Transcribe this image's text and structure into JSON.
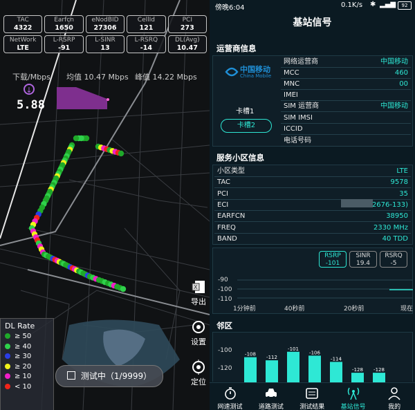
{
  "left": {
    "stats": [
      {
        "label": "TAC",
        "value": "4322"
      },
      {
        "label": "Earfcn",
        "value": "1650"
      },
      {
        "label": "eNodBID",
        "value": "27306"
      },
      {
        "label": "CellId",
        "value": "121"
      },
      {
        "label": "PCI",
        "value": "273"
      },
      {
        "label": "NetWork",
        "value": "LTE"
      },
      {
        "label": "L-RSRP",
        "value": "-91"
      },
      {
        "label": "L-SINR",
        "value": "13"
      },
      {
        "label": "L-RSRQ",
        "value": "-14"
      },
      {
        "label": "DL(Avg)",
        "value": "10.47"
      }
    ],
    "download_label": "下载/Mbps",
    "avg_label": "均值 10.47 Mbps",
    "peak_label": "峰值 14.22 Mbps",
    "current_speed": "5.88",
    "side_buttons": {
      "export": "导出",
      "settings": "设置",
      "locate": "定位"
    },
    "legend": {
      "title": "DL Rate",
      "items": [
        {
          "label": "≥ 50",
          "color": "#1fa82a"
        },
        {
          "label": "≥ 40",
          "color": "#2fd14b"
        },
        {
          "label": "≥ 30",
          "color": "#2a3de6"
        },
        {
          "label": "≥ 20",
          "color": "#f0f21a"
        },
        {
          "label": "≥ 10",
          "color": "#f01ec8"
        },
        {
          "label": "< 10",
          "color": "#f0241a"
        }
      ]
    },
    "test_button": "测试中（1/9999）"
  },
  "right": {
    "status": {
      "time": "傍晚6:04",
      "speed": "0.1K/s",
      "battery": "92"
    },
    "page_title": "基站信号",
    "operator_section": {
      "title": "运营商信息",
      "logo_cn": "中国移动",
      "logo_en": "China Mobile",
      "rows": [
        {
          "k": "网络运营商",
          "v": "中国移动"
        },
        {
          "k": "MCC",
          "v": "460"
        },
        {
          "k": "MNC",
          "v": "00"
        }
      ],
      "slot_label": "卡槽1",
      "slot2_button": "卡槽2",
      "sim_rows": [
        {
          "k": "IMEI",
          "v": ""
        },
        {
          "k": "SIM 运营商",
          "v": "中国移动"
        },
        {
          "k": "SIM IMSI",
          "v": ""
        },
        {
          "k": "ICCID",
          "v": ""
        },
        {
          "k": "电话号码",
          "v": ""
        }
      ]
    },
    "cell_section": {
      "title": "服务小区信息",
      "rows": [
        {
          "k": "小区类型",
          "v": "LTE"
        },
        {
          "k": "TAC",
          "v": "9578"
        },
        {
          "k": "PCI",
          "v": "35"
        },
        {
          "k": "ECI",
          "v": "208045      2676-133)"
        },
        {
          "k": "EARFCN",
          "v": "38950"
        },
        {
          "k": "FREQ",
          "v": "2330 MHz"
        },
        {
          "k": "BAND",
          "v": "40 TDD"
        }
      ]
    },
    "signal_chart": {
      "tabs": [
        {
          "name": "RSRP",
          "value": "-101",
          "active": true
        },
        {
          "name": "SINR",
          "value": "19.4",
          "active": false
        },
        {
          "name": "RSRQ",
          "value": "-5",
          "active": false
        }
      ],
      "y_ticks": [
        "-90",
        "-100",
        "-110"
      ],
      "x_ticks": [
        "1分钟前",
        "40秒前",
        "20秒前",
        "现在"
      ]
    },
    "neighbor_section": {
      "title": "邻区",
      "y_ticks": [
        "-100",
        "-120"
      ]
    },
    "nav": [
      {
        "label": "网速测试",
        "icon": "stopwatch-icon"
      },
      {
        "label": "道路测试",
        "icon": "car-icon"
      },
      {
        "label": "测试结果",
        "icon": "list-icon"
      },
      {
        "label": "基站信号",
        "icon": "antenna-icon",
        "active": true
      },
      {
        "label": "我的",
        "icon": "person-icon"
      }
    ],
    "accent": "#2ee8d5"
  },
  "chart_data": [
    {
      "type": "bar",
      "title": "邻区",
      "ylabel": "",
      "ylim": [
        -135,
        -95
      ],
      "values": [
        -108,
        -112,
        -101,
        -106,
        -114,
        -128,
        -128
      ],
      "data_labels": [
        "-108",
        "-112",
        "-101",
        "-106",
        "-114",
        "-128",
        "-128"
      ]
    },
    {
      "type": "line",
      "title": "RSRP",
      "ylim": [
        -115,
        -85
      ],
      "y_ticks": [
        -90,
        -100,
        -110
      ],
      "x_ticks": [
        "1分钟前",
        "40秒前",
        "20秒前",
        "现在"
      ],
      "series": [
        {
          "values": [
            -101
          ]
        }
      ]
    }
  ]
}
